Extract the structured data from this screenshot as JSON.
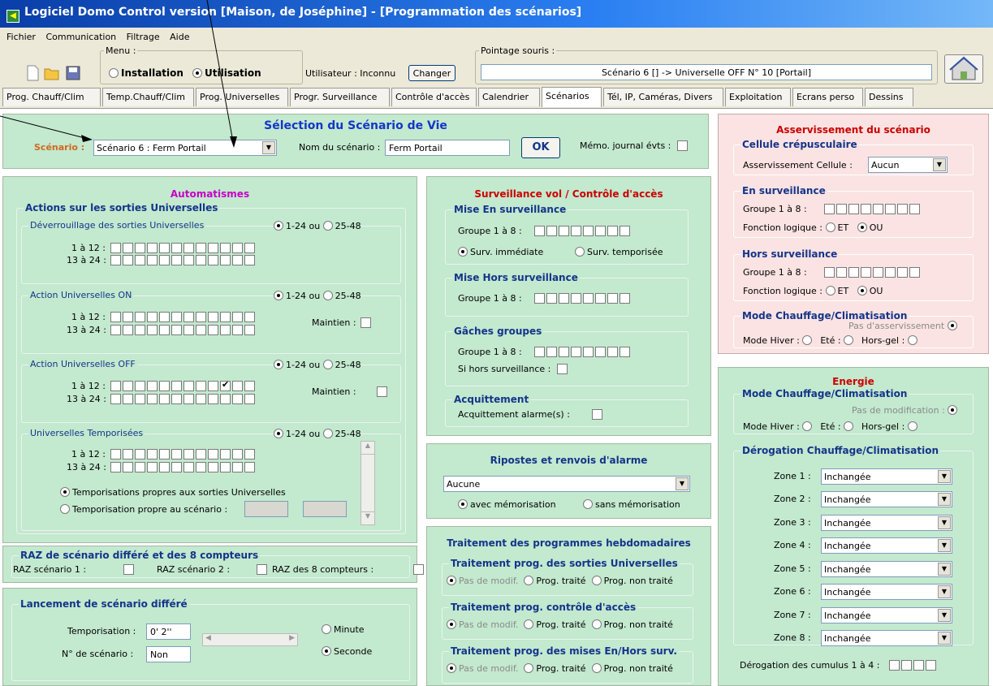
{
  "window": {
    "title": "Logiciel Domo Control version  [Maison, de Joséphine] - [Programmation des scénarios]"
  },
  "menu": [
    "Fichier",
    "Communication",
    "Filtrage",
    "Aide"
  ],
  "toolbar": {
    "menu_legend": "Menu :",
    "installation": "Installation",
    "utilisation": "Utilisation",
    "user_label": "Utilisateur : Inconnu",
    "change_btn": "Changer",
    "pointage_legend": "Pointage souris :",
    "pointage_value": "Scénario 6 [] -> Universelle OFF N° 10 [Portail]"
  },
  "tabs": [
    "Prog. Chauff/Clim",
    "Temp.Chauff/Clim",
    "Prog. Universelles",
    "Progr. Surveillance",
    "Contrôle d'accès",
    "Calendrier",
    "Scénarios",
    "Tél, IP, Caméras, Divers",
    "Exploitation",
    "Ecrans perso",
    "Dessins"
  ],
  "selection": {
    "title": "Sélection du Scénario de Vie",
    "scenario_label": "Scénario :",
    "scenario_value": "Scénario 6 : Ferm Portail",
    "name_label": "Nom du scénario :",
    "name_value": "Ferm Portail",
    "ok": "OK",
    "memo_label": "Mémo. journal évts :"
  },
  "auto": {
    "title": "Automatismes",
    "actions_legend": "Actions sur les sorties Universelles",
    "range1": "1-24 ou",
    "range2": "25-48",
    "row1": "1 à 12 :",
    "row2": "13 à 24 :",
    "maintien": "Maintien :",
    "g1": "Déverrouillage des sorties Universelles",
    "g2": "Action Universelles ON",
    "g3": "Action Universelles OFF",
    "g4": "Universelles Temporisées",
    "tempo_own": "Temporisations propres aux sorties Universelles",
    "tempo_scen": "Temporisation propre au scénario :"
  },
  "raz": {
    "legend": "RAZ de scénario différé et des 8 compteurs",
    "raz1": "RAZ scénario 1 :",
    "raz2": "RAZ scénario 2 :",
    "raz8": "RAZ des 8 compteurs :"
  },
  "launch": {
    "legend": "Lancement de scénario différé",
    "tempo_label": "Temporisation :",
    "tempo_value": "0' 2''",
    "num_label": "N° de scénario :",
    "num_value": "Non",
    "minute": "Minute",
    "seconde": "Seconde"
  },
  "surv": {
    "title": "Surveillance vol / Contrôle d'accès",
    "mise": "Mise En surveillance",
    "group": "Groupe 1 à 8 :",
    "imm": "Surv. immédiate",
    "temp": "Surv. temporisée",
    "hors": "Mise Hors surveillance",
    "gaches": "Gâches groupes",
    "si_hors": "Si hors surveillance :",
    "ack": "Acquittement",
    "ack_label": "Acquittement alarme(s) :"
  },
  "ripostes": {
    "title": "Ripostes et renvois d'alarme",
    "value": "Aucune",
    "avec": "avec mémorisation",
    "sans": "sans mémorisation"
  },
  "hebdo": {
    "title": "Traitement des programmes hebdomadaires",
    "g1": "Traitement prog. des sorties Universelles",
    "g2": "Traitement prog. contrôle d'accès",
    "g3": "Traitement prog. des mises En/Hors surv.",
    "pas": "Pas de modif.",
    "traite": "Prog. traité",
    "non": "Prog. non traité"
  },
  "asserv": {
    "title": "Asservissement du scénario",
    "cell": "Cellule crépusculaire",
    "cell_label": "Asservissement Cellule :",
    "cell_value": "Aucun",
    "en": "En surveillance",
    "group": "Groupe 1 à 8 :",
    "fl": "Fonction logique :",
    "et": "ET",
    "ou": "OU",
    "hors": "Hors surveillance",
    "mode": "Mode Chauffage/Climatisation",
    "pas": "Pas d'asservissement",
    "hiver": "Mode Hiver :",
    "ete": "Eté :",
    "hg": "Hors-gel :"
  },
  "energie": {
    "title": "Energie",
    "mode": "Mode Chauffage/Climatisation",
    "pas": "Pas de modification :",
    "hiver": "Mode Hiver :",
    "ete": "Eté :",
    "hg": "Hors-gel :",
    "derog": "Dérogation Chauffage/Climatisation",
    "zones": [
      "Zone 1 :",
      "Zone 2 :",
      "Zone 3 :",
      "Zone 4 :",
      "Zone 5 :",
      "Zone 6 :",
      "Zone 7 :",
      "Zone 8 :"
    ],
    "zone_value": "Inchangée",
    "cumulus": "Dérogation des cumulus 1 à 4 :"
  }
}
